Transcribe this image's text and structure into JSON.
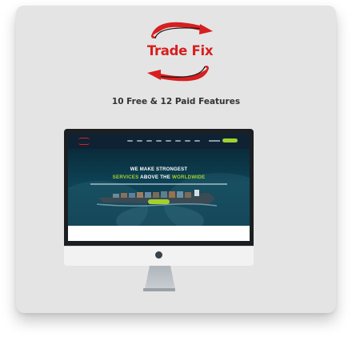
{
  "brand": {
    "name": "Trade Fix",
    "accent": "#d71f1f"
  },
  "features_text": "10 Free & 12 Paid Features",
  "preview": {
    "hero_line1": "WE MAKE STRONGEST",
    "hero_line2_a": "SERVICES",
    "hero_line2_b": "ABOVE THE",
    "hero_line2_c": "WORLDWIDE",
    "accent_green": "#a3d12c",
    "header_bg": "#0e2233"
  }
}
